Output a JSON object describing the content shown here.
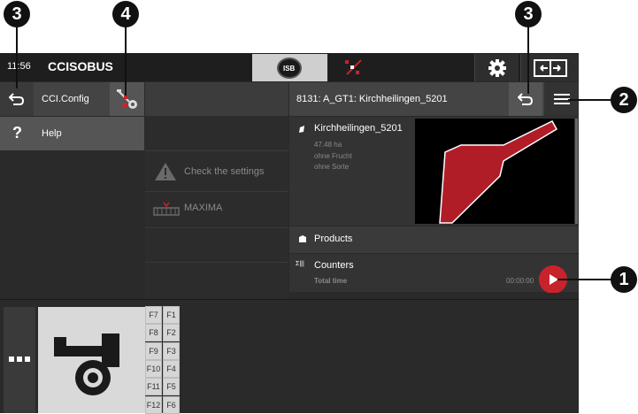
{
  "top_bar": {
    "clock": "11:56",
    "logo": "CCISOBUS",
    "isb_label": "ISB"
  },
  "left_panel": {
    "config_label": "CCI.Config",
    "help_label": "Help"
  },
  "middle_panel": {
    "warning_label": "Check the settings",
    "machine_label": "MAXIMA"
  },
  "right_panel": {
    "title": "8131: A_GT1: Kirchheilingen_5201",
    "field": {
      "name": "Kirchheilingen_5201",
      "area": "47.48 ha",
      "crop": "ohne Frucht",
      "variety": "ohne Sorte"
    },
    "products_label": "Products",
    "counters_label": "Counters",
    "counters_icon_text": "Σ|||",
    "total_time_label": "Total time",
    "total_time_value": "00:00:00"
  },
  "bottom": {
    "fkeys": [
      [
        "F7",
        "F1"
      ],
      [
        "F8",
        "F2"
      ],
      [
        "F9",
        "F3"
      ],
      [
        "F10",
        "F4"
      ],
      [
        "F11",
        "F5"
      ],
      [
        "F12",
        "F6"
      ]
    ]
  },
  "callouts": [
    "3",
    "4",
    "3",
    "2",
    "1"
  ],
  "colors": {
    "background": "#2b2b2b",
    "topbar": "#1e1e1e",
    "accent_red": "#c8232b",
    "field_red": "#b11d27"
  }
}
